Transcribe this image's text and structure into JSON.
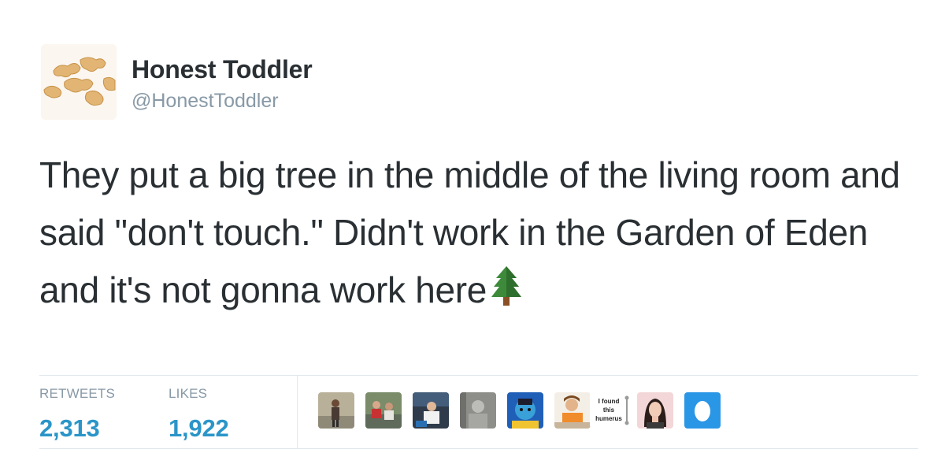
{
  "tweet": {
    "author": {
      "name": "Honest Toddler",
      "handle": "@HonestToddler",
      "avatar": "animal-crackers-avatar"
    },
    "text": "They put a big tree in the middle of the living room and said \"don't touch.\" Didn't work in the Garden of Eden and it's not gonna work here",
    "emoji": "evergreen-tree-icon"
  },
  "stats": {
    "retweets": {
      "label": "RETWEETS",
      "value": "2,313"
    },
    "likes": {
      "label": "LIKES",
      "value": "1,922"
    }
  },
  "likers": [
    {
      "avatar": "person-standing-avatar"
    },
    {
      "avatar": "group-photo-avatar"
    },
    {
      "avatar": "seated-person-avatar"
    },
    {
      "avatar": "gray-photo-avatar"
    },
    {
      "avatar": "blue-portrait-avatar"
    },
    {
      "avatar": "orange-child-avatar"
    },
    {
      "avatar": "humerus-text-avatar",
      "text": "I found this humerus"
    },
    {
      "avatar": "woman-portrait-avatar"
    },
    {
      "avatar": "default-egg-avatar"
    }
  ],
  "colors": {
    "text": "#292f33",
    "muted": "#8899a6",
    "count": "#2b95c8",
    "divider": "#e1e8ed",
    "egg": "#2a96e6"
  }
}
